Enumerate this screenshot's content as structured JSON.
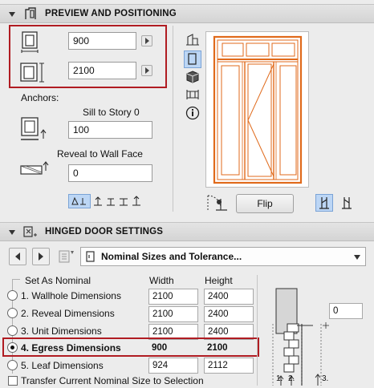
{
  "preview": {
    "title": "PREVIEW AND POSITIONING",
    "width_value": "900",
    "height_value": "2100",
    "anchors_label": "Anchors:",
    "sill_label": "Sill to Story 0",
    "sill_value": "100",
    "reveal_label": "Reveal to Wall Face",
    "reveal_value": "0",
    "flip_label": "Flip"
  },
  "hinged": {
    "title": "HINGED DOOR SETTINGS",
    "dropdown_label": "Nominal Sizes and Tolerance...",
    "set_as_nominal": "Set As Nominal",
    "col_width": "Width",
    "col_height": "Height",
    "rows": [
      {
        "label": "1. Wallhole Dimensions",
        "width": "2100",
        "height": "2400",
        "checked": false
      },
      {
        "label": "2. Reveal Dimensions",
        "width": "2100",
        "height": "2400",
        "checked": false
      },
      {
        "label": "3. Unit Dimensions",
        "width": "2100",
        "height": "2400",
        "checked": false
      },
      {
        "label": "4. Egress Dimensions",
        "width": "900",
        "height": "2100",
        "checked": true
      },
      {
        "label": "5. Leaf Dimensions",
        "width": "924",
        "height": "2112",
        "checked": false
      }
    ],
    "transfer_label": "Transfer Current Nominal Size to Selection",
    "side_value": "0",
    "diagram_labels": [
      "1.",
      "2.",
      "3."
    ]
  },
  "colors": {
    "accent_red": "#b01c22",
    "door_orange": "#e06a1b",
    "selected_blue": "#bcd6f5"
  }
}
